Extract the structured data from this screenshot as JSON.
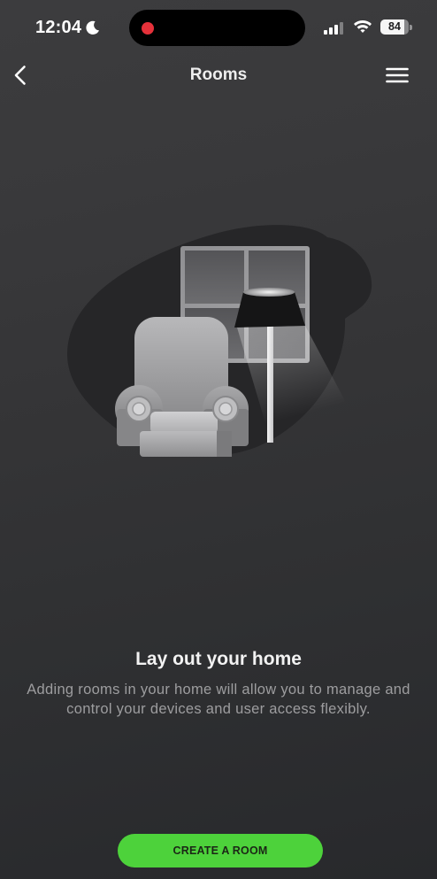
{
  "status_bar": {
    "time": "12:04",
    "battery_percent": "84",
    "battery_level": 84,
    "signal_bars": 3,
    "icons": {
      "focus": "moon-icon",
      "recording": "recording-dot-icon",
      "signal": "cellular-signal-icon",
      "wifi": "wifi-icon",
      "battery": "battery-icon"
    }
  },
  "header": {
    "title": "Rooms",
    "back_icon": "chevron-left-icon",
    "menu_icon": "hamburger-menu-icon"
  },
  "empty_state": {
    "title": "Lay out your home",
    "description": "Adding rooms in your home will allow you to manage and control your devices and user access flexibly."
  },
  "primary_action": {
    "label": "CREATE A ROOM"
  },
  "colors": {
    "accent": "#4dd23b",
    "accent_text": "#1b2616",
    "text_primary": "#f2f2f2",
    "text_secondary": "#9d9d9f",
    "recording_dot": "#e5313a",
    "background_top": "#3c3c3e",
    "background_bottom": "#28292c"
  }
}
